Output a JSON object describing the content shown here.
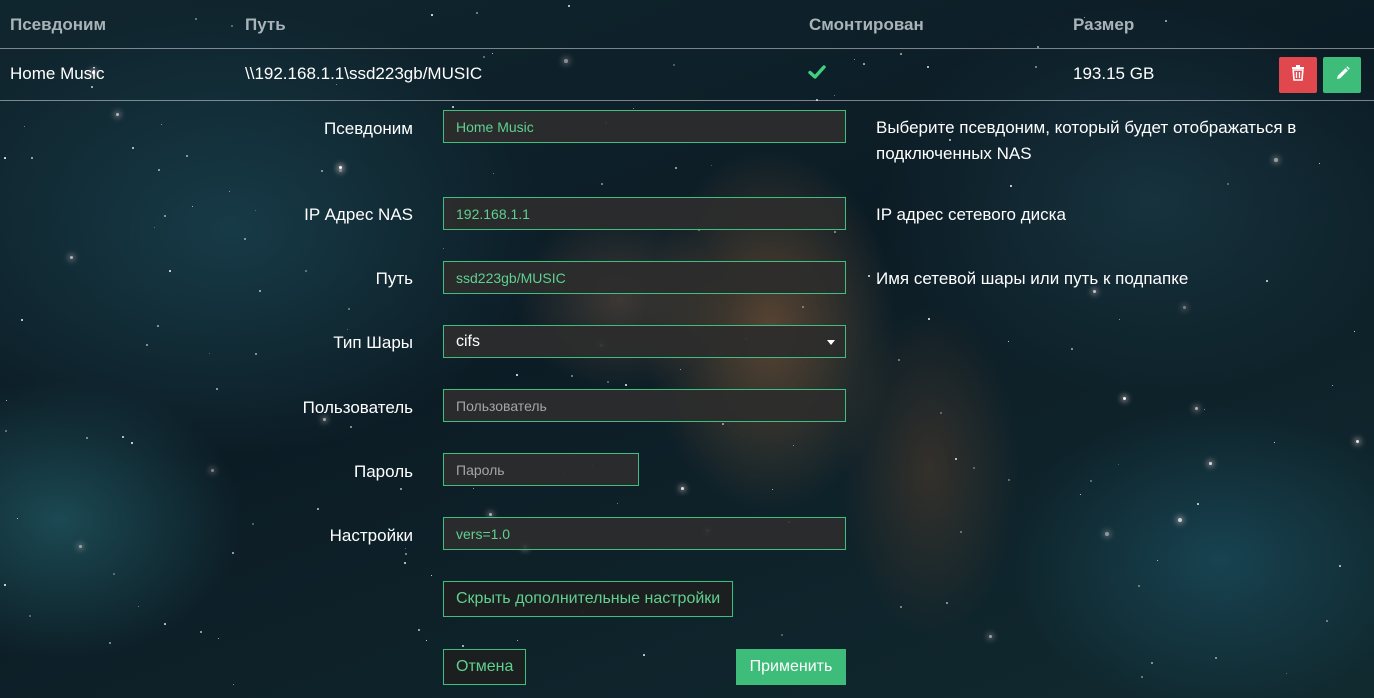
{
  "table": {
    "headers": {
      "alias": "Псевдоним",
      "path": "Путь",
      "mounted": "Смонтирован",
      "size": "Размер"
    },
    "rows": [
      {
        "alias": "Home Music",
        "path": "\\\\192.168.1.1\\ssd223gb/MUSIC",
        "mounted": true,
        "size": "193.15 GB"
      }
    ]
  },
  "form": {
    "alias": {
      "label": "Псевдоним",
      "value": "Home Music",
      "help": "Выберите псевдоним, который будет отображаться в подключенных NAS"
    },
    "ip": {
      "label": "IP Адрес NAS",
      "value": "192.168.1.1",
      "help": "IP адрес сетевого диска"
    },
    "path": {
      "label": "Путь",
      "value": "ssd223gb/MUSIC",
      "help": "Имя сетевой шары или путь к подпапке"
    },
    "share_type": {
      "label": "Тип Шары",
      "selected": "cifs"
    },
    "user": {
      "label": "Пользователь",
      "value": "",
      "placeholder": "Пользователь"
    },
    "password": {
      "label": "Пароль",
      "value": "",
      "placeholder": "Пароль"
    },
    "options": {
      "label": "Настройки",
      "value": "vers=1.0"
    },
    "hide_advanced_label": "Скрыть дополнительные настройки",
    "cancel_label": "Отмена",
    "apply_label": "Применить"
  },
  "colors": {
    "accent": "#3ebd7a",
    "danger": "#e0484d"
  },
  "icons": {
    "mounted": "check-icon",
    "delete": "trash-icon",
    "edit": "pencil-icon"
  }
}
